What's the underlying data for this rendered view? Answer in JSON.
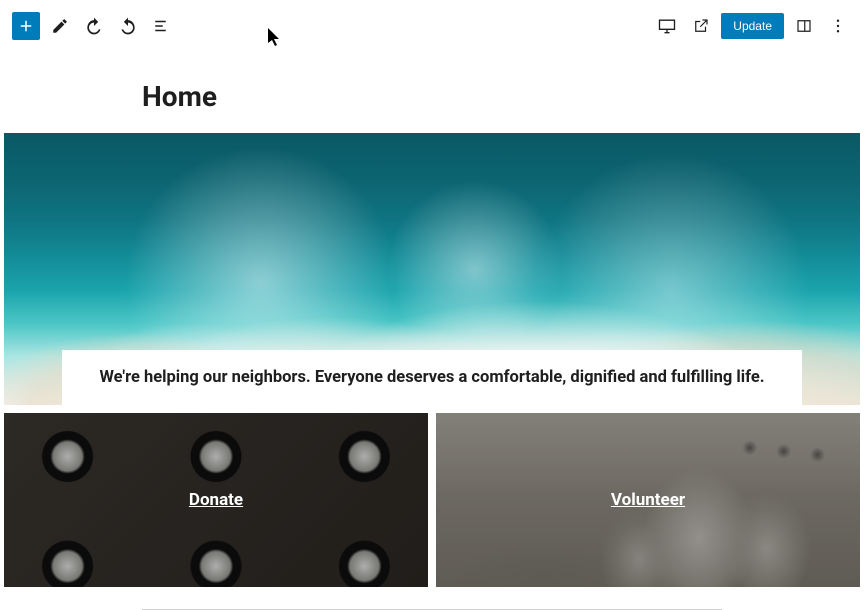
{
  "toolbar": {
    "update_label": "Update"
  },
  "page": {
    "title": "Home"
  },
  "hero": {
    "text": "We're helping our neighbors. Everyone deserves a comfortable, dignified and fulfilling life."
  },
  "cards": [
    {
      "label": "Donate"
    },
    {
      "label": "Volunteer"
    }
  ]
}
